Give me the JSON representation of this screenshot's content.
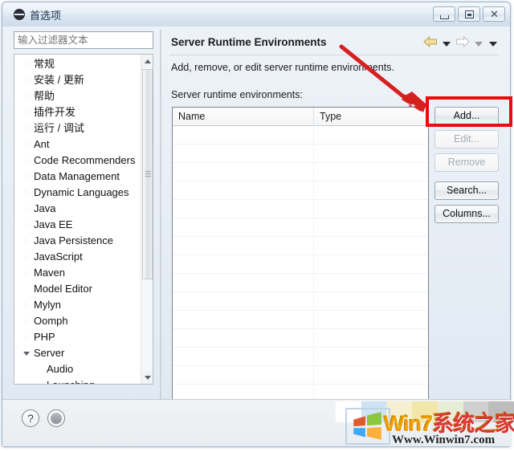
{
  "window": {
    "title": "首选项",
    "icon": "eclipse-icon",
    "controls": {
      "minimize": "minimize-icon",
      "restore": "restore-icon",
      "close": "✕"
    }
  },
  "sidebar": {
    "filter": {
      "placeholder": "输入过滤器文本",
      "value": ""
    },
    "items": [
      {
        "label": "常规",
        "state": "collapsed",
        "level": 0
      },
      {
        "label": "安装 / 更新",
        "state": "collapsed",
        "level": 0
      },
      {
        "label": "帮助",
        "state": "collapsed",
        "level": 0
      },
      {
        "label": "插件开发",
        "state": "collapsed",
        "level": 0
      },
      {
        "label": "运行 / 调试",
        "state": "collapsed",
        "level": 0
      },
      {
        "label": "Ant",
        "state": "collapsed",
        "level": 0
      },
      {
        "label": "Code Recommenders",
        "state": "collapsed",
        "level": 0
      },
      {
        "label": "Data Management",
        "state": "collapsed",
        "level": 0
      },
      {
        "label": "Dynamic Languages",
        "state": "collapsed",
        "level": 0
      },
      {
        "label": "Java",
        "state": "collapsed",
        "level": 0
      },
      {
        "label": "Java EE",
        "state": "collapsed",
        "level": 0
      },
      {
        "label": "Java Persistence",
        "state": "collapsed",
        "level": 0
      },
      {
        "label": "JavaScript",
        "state": "collapsed",
        "level": 0
      },
      {
        "label": "Maven",
        "state": "collapsed",
        "level": 0
      },
      {
        "label": "Model Editor",
        "state": "leaf",
        "level": 0
      },
      {
        "label": "Mylyn",
        "state": "collapsed",
        "level": 0
      },
      {
        "label": "Oomph",
        "state": "collapsed",
        "level": 0
      },
      {
        "label": "PHP",
        "state": "collapsed",
        "level": 0
      },
      {
        "label": "Server",
        "state": "expanded",
        "level": 0
      },
      {
        "label": "Audio",
        "state": "leaf",
        "level": 1
      },
      {
        "label": "Launching",
        "state": "leaf",
        "level": 1
      }
    ]
  },
  "main": {
    "title": "Server Runtime Environments",
    "description": "Add, remove, or edit server runtime environments.",
    "list_label": "Server runtime environments:",
    "nav": {
      "back_icon": "back-arrow-icon",
      "back_menu_icon": "chevron-down-icon",
      "forward_icon": "forward-arrow-icon",
      "forward_menu_icon": "chevron-down-icon",
      "view_menu_icon": "chevron-down-icon"
    },
    "table": {
      "columns": [
        "Name",
        "Type"
      ],
      "rows": []
    },
    "buttons": [
      {
        "label": "Add...",
        "enabled": true,
        "highlighted": true
      },
      {
        "label": "Edit...",
        "enabled": false,
        "highlighted": false
      },
      {
        "label": "Remove",
        "enabled": false,
        "highlighted": false
      },
      {
        "label": "Search...",
        "enabled": true,
        "highlighted": false
      },
      {
        "label": "Columns...",
        "enabled": true,
        "highlighted": false
      }
    ]
  },
  "footer": {
    "help_label": "?",
    "apply_icon": "apply-icon"
  },
  "annotation": {
    "color": "#e60d0d",
    "target": "Add... button"
  },
  "watermark": {
    "brand_latin": "Win7",
    "brand_cn": "系统之家",
    "url": "Www.Winwin7.com"
  },
  "colors": {
    "accent": "#e60d0d",
    "titlebar": "#dbe6f1",
    "brand_orange": "#f0a000",
    "brand_red": "#d93838"
  }
}
